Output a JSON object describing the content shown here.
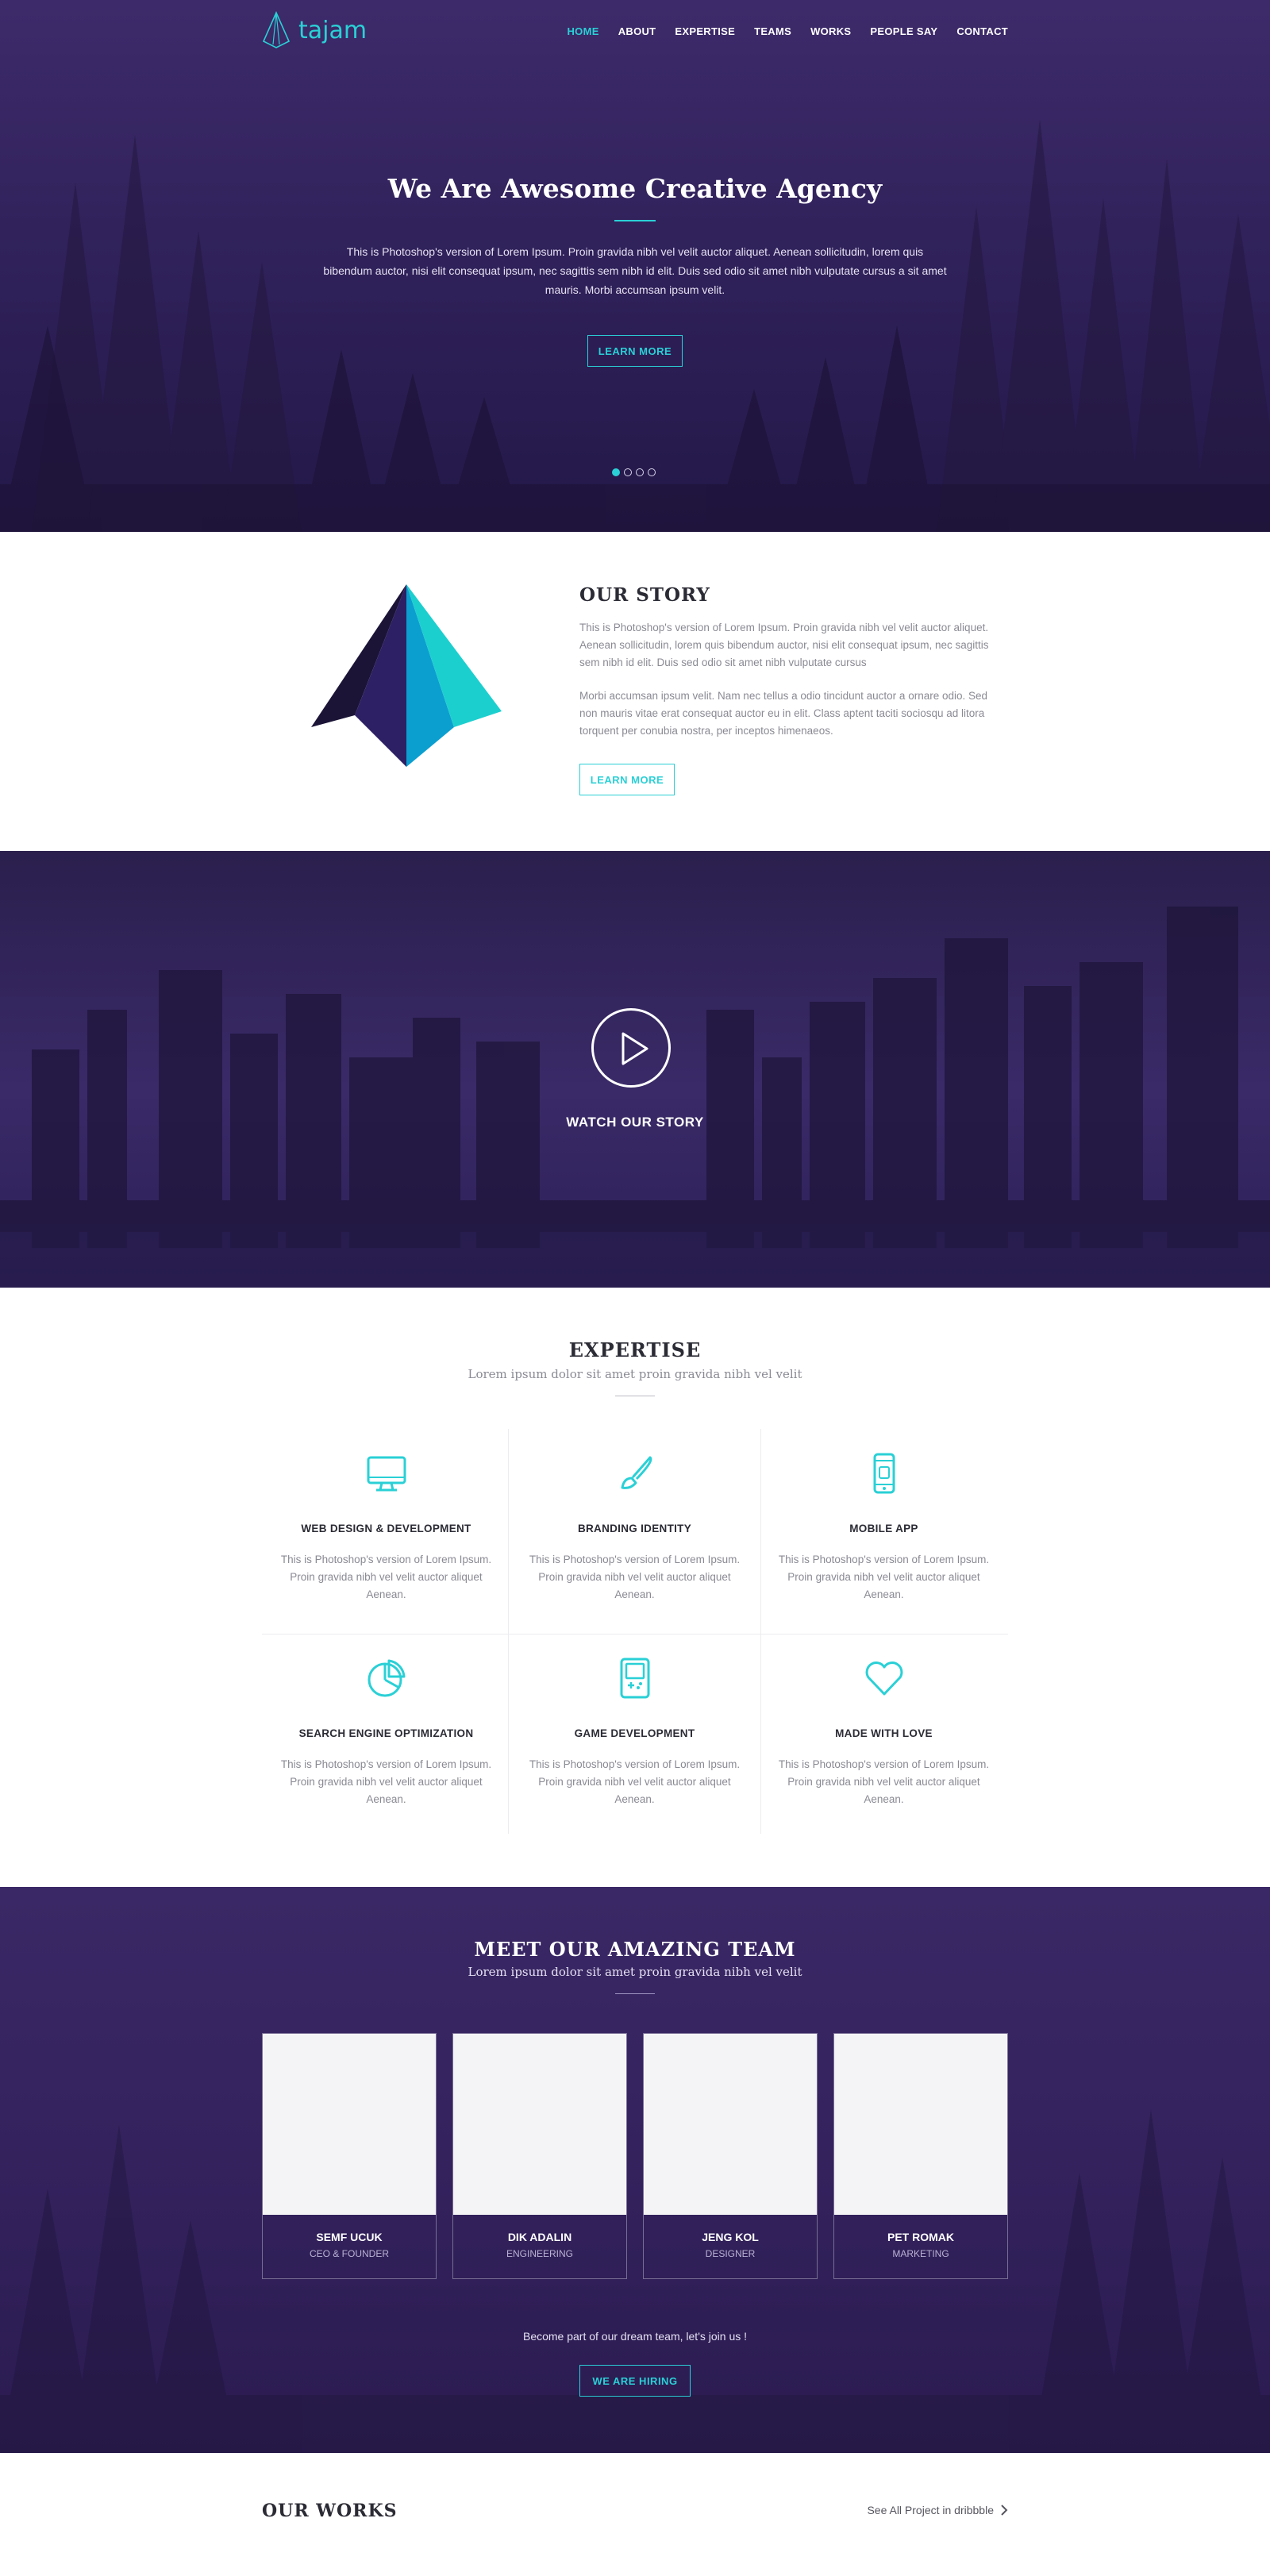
{
  "nav": {
    "logo_text": "tajam",
    "items": [
      "HOME",
      "ABOUT",
      "EXPERTISE",
      "TEAMS",
      "WORKS",
      "PEOPLE SAY",
      "CONTACT"
    ],
    "active": "HOME"
  },
  "hero": {
    "title": "We Are Awesome Creative Agency",
    "text": "This is Photoshop's version  of Lorem Ipsum. Proin gravida nibh vel velit auctor aliquet. Aenean sollicitudin, lorem quis bibendum auctor, nisi elit consequat ipsum, nec sagittis sem nibh id elit. Duis sed odio sit amet nibh vulputate cursus a sit amet mauris. Morbi accumsan ipsum velit.",
    "button": "LEARN MORE",
    "slides": 4,
    "active_slide": 1
  },
  "story": {
    "title": "OUR STORY",
    "p1": "This is Photoshop's version  of Lorem Ipsum. Proin gravida nibh vel velit auctor aliquet. Aenean sollicitudin, lorem quis bibendum auctor, nisi elit consequat ipsum, nec sagittis sem nibh id elit. Duis sed odio sit amet nibh vulputate cursus",
    "p2": "Morbi accumsan ipsum velit. Nam nec tellus a odio tincidunt auctor a ornare odio. Sed non  mauris vitae erat consequat auctor eu in elit. Class aptent taciti sociosqu ad litora torquent per conubia nostra, per inceptos himenaeos.",
    "button": "LEARN MORE"
  },
  "video": {
    "label": "WATCH OUR STORY"
  },
  "expertise": {
    "title": "EXPERTISE",
    "subtitle": "Lorem ipsum dolor sit amet proin gravida nibh vel velit",
    "items": [
      {
        "icon": "monitor-icon",
        "title": "WEB DESIGN & DEVELOPMENT",
        "text": "This is Photoshop's version  of Lorem Ipsum. Proin gravida nibh vel velit auctor aliquet Aenean."
      },
      {
        "icon": "brush-icon",
        "title": "BRANDING IDENTITY",
        "text": "This is Photoshop's version  of Lorem Ipsum. Proin gravida nibh vel velit auctor aliquet Aenean."
      },
      {
        "icon": "phone-icon",
        "title": "MOBILE APP",
        "text": "This is Photoshop's version  of Lorem Ipsum. Proin gravida nibh vel velit auctor aliquet Aenean."
      },
      {
        "icon": "pie-chart-icon",
        "title": "SEARCH ENGINE OPTIMIZATION",
        "text": "This is Photoshop's version  of Lorem Ipsum. Proin gravida nibh vel velit auctor aliquet Aenean."
      },
      {
        "icon": "gameboy-icon",
        "title": "GAME DEVELOPMENT",
        "text": "This is Photoshop's version  of Lorem Ipsum. Proin gravida nibh vel velit auctor aliquet Aenean."
      },
      {
        "icon": "heart-icon",
        "title": "MADE WITH LOVE",
        "text": "This is Photoshop's version  of Lorem Ipsum. Proin gravida nibh vel velit auctor aliquet Aenean."
      }
    ]
  },
  "team": {
    "title": "MEET OUR AMAZING TEAM",
    "subtitle": "Lorem ipsum dolor sit amet proin gravida nibh vel velit",
    "members": [
      {
        "name": "SEMF UCUK",
        "role": "CEO & FOUNDER"
      },
      {
        "name": "DIK ADALIN",
        "role": "ENGINEERING"
      },
      {
        "name": "JENG KOL",
        "role": "DESIGNER"
      },
      {
        "name": "PET ROMAK",
        "role": "MARKETING"
      }
    ],
    "join_text": "Become part of our dream team, let's join us !",
    "button": "WE ARE HIRING"
  },
  "works": {
    "title": "OUR WORKS",
    "link": "See All Project in dribbble"
  },
  "colors": {
    "accent": "#2ad0d6",
    "hero_bg": "#2e2058",
    "heading": "#2b2b35",
    "muted_text": "#8a8a94"
  }
}
